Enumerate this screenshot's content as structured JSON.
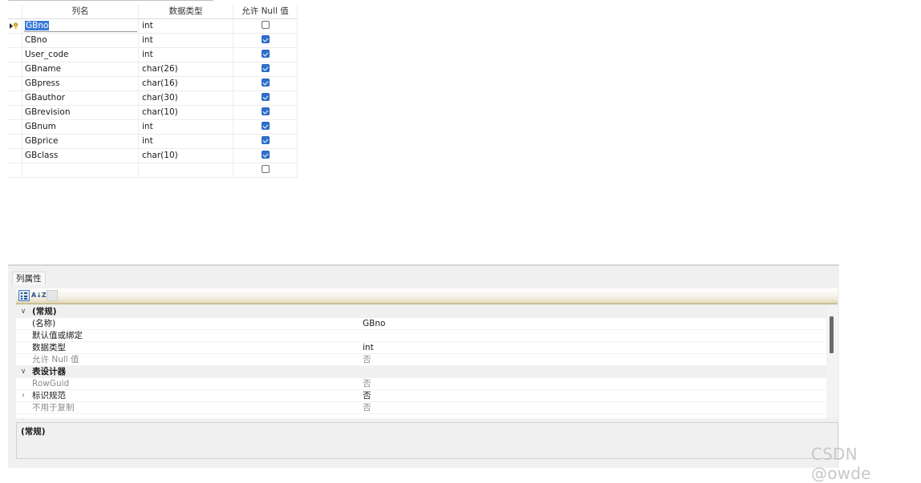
{
  "table_designer": {
    "headers": {
      "column_name": "列名",
      "data_type": "数据类型",
      "allow_null": "允许 Null 值"
    },
    "rows": [
      {
        "name": "GBno",
        "type": "int",
        "allow_null": false,
        "primary_key": true,
        "selected": true
      },
      {
        "name": "CBno",
        "type": "int",
        "allow_null": true
      },
      {
        "name": "User_code",
        "type": "int",
        "allow_null": true
      },
      {
        "name": "GBname",
        "type": "char(26)",
        "allow_null": true
      },
      {
        "name": "GBpress",
        "type": "char(16)",
        "allow_null": true
      },
      {
        "name": "GBauthor",
        "type": "char(30)",
        "allow_null": true
      },
      {
        "name": "GBrevision",
        "type": "char(10)",
        "allow_null": true
      },
      {
        "name": "GBnum",
        "type": "int",
        "allow_null": true
      },
      {
        "name": "GBprice",
        "type": "int",
        "allow_null": true
      },
      {
        "name": "GBclass",
        "type": "char(10)",
        "allow_null": true
      },
      {
        "name": "",
        "type": "",
        "allow_null": false
      }
    ],
    "icons": {
      "primary_key_row_marker": "key-arrow-icon"
    }
  },
  "properties_panel": {
    "tab_label": "列属性",
    "toolbar": {
      "categorized_icon": "categorized-icon",
      "alphabetical_icon": "sort-az-icon",
      "alphabetical_label": "A↓Z",
      "pages_icon": "property-pages-icon"
    },
    "rows": [
      {
        "kind": "category",
        "expander": "∨",
        "name": "(常规)",
        "value": ""
      },
      {
        "kind": "property",
        "name": "(名称)",
        "value": "GBno",
        "dim": false
      },
      {
        "kind": "property",
        "name": "默认值或绑定",
        "value": "",
        "dim": false
      },
      {
        "kind": "property",
        "name": "数据类型",
        "value": "int",
        "dim": false
      },
      {
        "kind": "property",
        "name": "允许 Null 值",
        "value": "否",
        "dim": true
      },
      {
        "kind": "category",
        "expander": "∨",
        "name": "表设计器",
        "value": ""
      },
      {
        "kind": "property",
        "name": "RowGuid",
        "value": "否",
        "dim": true
      },
      {
        "kind": "property",
        "expander": "›",
        "name": "标识规范",
        "value": "否",
        "dim": false
      },
      {
        "kind": "property",
        "name": "不用于复制",
        "value": "否",
        "dim": true
      }
    ],
    "description_title": "(常规)"
  },
  "watermark": "CSDN @owde",
  "colors": {
    "checkbox_checked": "#2f6fce",
    "selection": "#3b7ad8",
    "category_row": "#f0f0f0",
    "toolbar_accent": "#b8a676"
  }
}
